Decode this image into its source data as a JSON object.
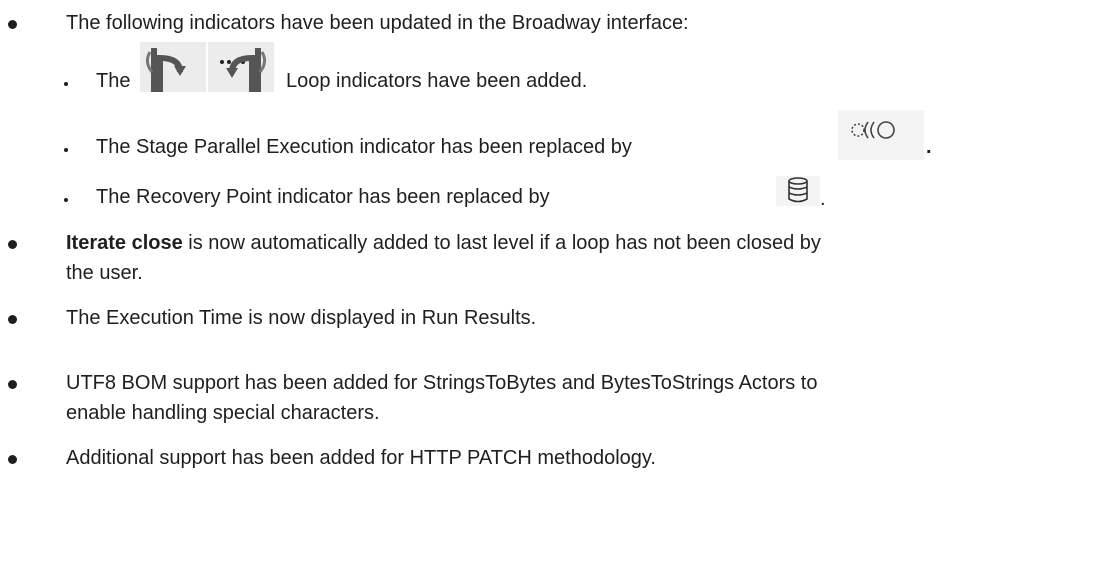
{
  "items": {
    "i1": {
      "text": "The following indicators have been updated in the Broadway interface:"
    },
    "i1_sub": {
      "s1": {
        "pre": "The",
        "post": "Loop indicators have been added.",
        "icon": "loop-indicators-icon"
      },
      "s2": {
        "pre": "The Stage Parallel Execution indicator has been replaced by",
        "post": ".",
        "icon": "parallel-execution-icon"
      },
      "s3": {
        "pre": "The Recovery Point indicator has been replaced by",
        "post": ".",
        "icon": "database-icon"
      }
    },
    "i2": {
      "bold": "Iterate close",
      "rest": "is now automatically added to last level if a loop has not been closed by",
      "line2": "the user."
    },
    "i3": {
      "text": "The Execution Time is now displayed in Run Results."
    },
    "i4": {
      "line1": "UTF8 BOM support has been added for StringsToBytes and BytesToStrings Actors to",
      "line2": "enable handling special characters."
    },
    "i5": {
      "text": "Additional support has been added for HTTP PATCH methodology."
    }
  }
}
